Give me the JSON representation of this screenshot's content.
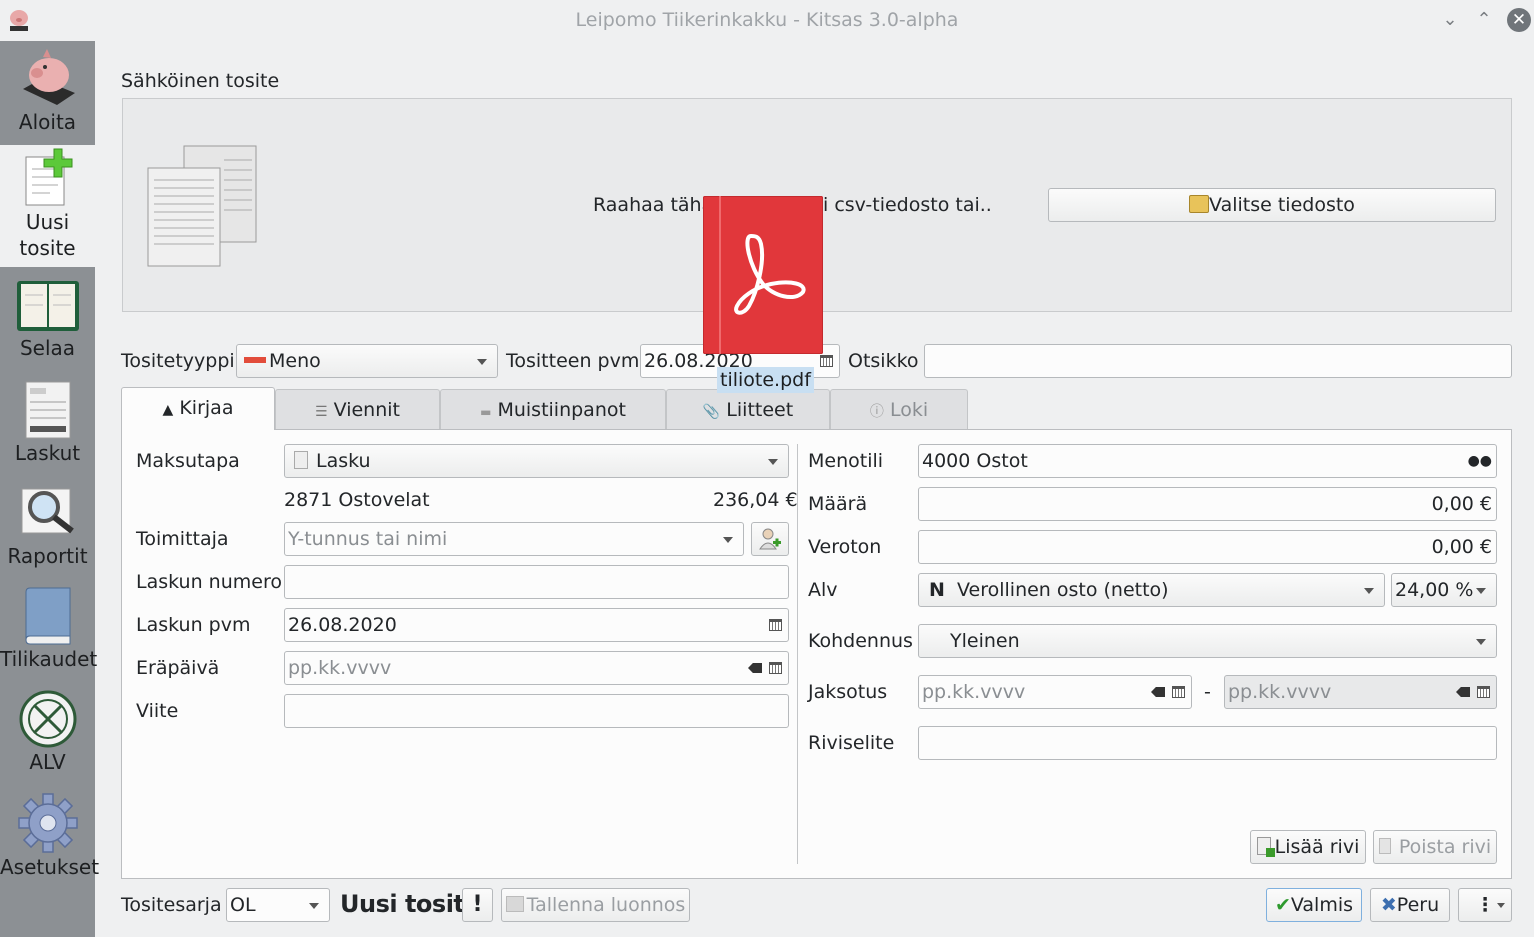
{
  "window": {
    "title": "Leipomo Tiikerinkakku - Kitsas 3.0-alpha"
  },
  "sidebar": {
    "items": [
      {
        "label": "Aloita"
      },
      {
        "label": "Uusi tosite"
      },
      {
        "label": "Selaa"
      },
      {
        "label": "Laskut"
      },
      {
        "label": "Raportit"
      },
      {
        "label": "Tilikaudet"
      },
      {
        "label": "ALV"
      },
      {
        "label": "Asetukset"
      }
    ]
  },
  "sahkoinen": {
    "heading": "Sähköinen tosite",
    "prompt_left": "Raahaa tähä",
    "prompt_right": "i csv-tiedosto tai..",
    "choose_file_label": "Valitse tiedosto"
  },
  "drag": {
    "file_name": "tiliote.pdf"
  },
  "header": {
    "type_label": "Tositetyyppi",
    "type_value": "Meno",
    "date_label": "Tositteen pvm",
    "date_value": "26.08.2020",
    "title_label": "Otsikko",
    "title_value": ""
  },
  "tabs": [
    {
      "label": "Kirjaa",
      "icon": "stamp-icon"
    },
    {
      "label": "Viennit",
      "icon": "list-icon"
    },
    {
      "label": "Muistiinpanot",
      "icon": "note-icon"
    },
    {
      "label": "Liitteet",
      "icon": "paperclip-icon"
    },
    {
      "label": "Loki",
      "icon": "info-icon"
    }
  ],
  "left_form": {
    "payment_label": "Maksutapa",
    "payment_value": "Lasku",
    "account_text": "2871 Ostovelat",
    "account_amount": "236,04 €",
    "supplier_label": "Toimittaja",
    "supplier_placeholder": "Y-tunnus tai nimi",
    "invoice_number_label": "Laskun numero",
    "invoice_number_value": "",
    "invoice_date_label": "Laskun pvm",
    "invoice_date_value": "26.08.2020",
    "due_date_label": "Eräpäivä",
    "due_date_placeholder": "pp.kk.vvvv",
    "reference_label": "Viite",
    "reference_value": ""
  },
  "right_form": {
    "expense_account_label": "Menotili",
    "expense_account_value": "4000 Ostot",
    "amount_label": "Määrä",
    "amount_value": "0,00 €",
    "net_label": "Veroton",
    "net_value": "0,00 €",
    "vat_label": "Alv",
    "vat_code": "N",
    "vat_value": "Verollinen osto (netto)",
    "vat_rate": "24,00 %",
    "allocation_label": "Kohdennus",
    "allocation_value": "Yleinen",
    "period_label": "Jaksotus",
    "period_from_placeholder": "pp.kk.vvvv",
    "period_separator": "-",
    "period_to_placeholder": "pp.kk.vvvv",
    "row_desc_label": "Riviselite",
    "row_desc_value": "",
    "add_row_label": "Lisää rivi",
    "remove_row_label": "Poista rivi"
  },
  "footer": {
    "series_label": "Tositesarja",
    "series_value": "OL",
    "doc_title": "Uusi tosite",
    "warning_label": "!",
    "save_draft_label": "Tallenna luonnos",
    "done_label": "Valmis",
    "cancel_label": "Peru",
    "more_label": "⋮"
  },
  "colors": {
    "sidebar_bg": "#8c9094",
    "window_bg": "#eff0f1",
    "pdf_red": "#e1373b",
    "drop_highlight": "#c8dff2"
  }
}
